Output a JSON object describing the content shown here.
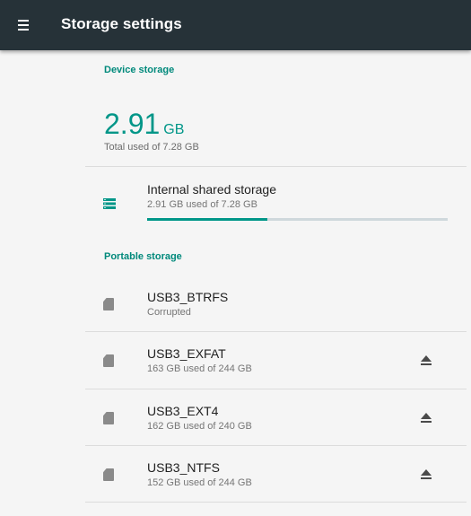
{
  "appbar": {
    "title": "Storage settings",
    "menu_icon": "hamburger-menu-icon",
    "background": "#263238"
  },
  "device_storage": {
    "header": "Device storage",
    "total_value": "2.91",
    "total_unit": "GB",
    "total_sub": "Total used of 7.28 GB",
    "internal": {
      "icon": "storage-list-icon",
      "title": "Internal shared storage",
      "subtitle": "2.91 GB used of 7.28 GB",
      "used_fraction": 0.4
    }
  },
  "portable_storage": {
    "header": "Portable storage",
    "items": [
      {
        "icon": "sd-card-icon",
        "title": "USB3_BTRFS",
        "subtitle": "Corrupted",
        "ejectable": false
      },
      {
        "icon": "sd-card-icon",
        "title": "USB3_EXFAT",
        "subtitle": "163 GB used of 244 GB",
        "ejectable": true
      },
      {
        "icon": "sd-card-icon",
        "title": "USB3_EXT4",
        "subtitle": "162 GB used of 240 GB",
        "ejectable": true
      },
      {
        "icon": "sd-card-icon",
        "title": "USB3_NTFS",
        "subtitle": "152 GB used of 244 GB",
        "ejectable": true
      }
    ]
  },
  "colors": {
    "accent": "#009688",
    "progress_track": "#cfd8dc"
  }
}
